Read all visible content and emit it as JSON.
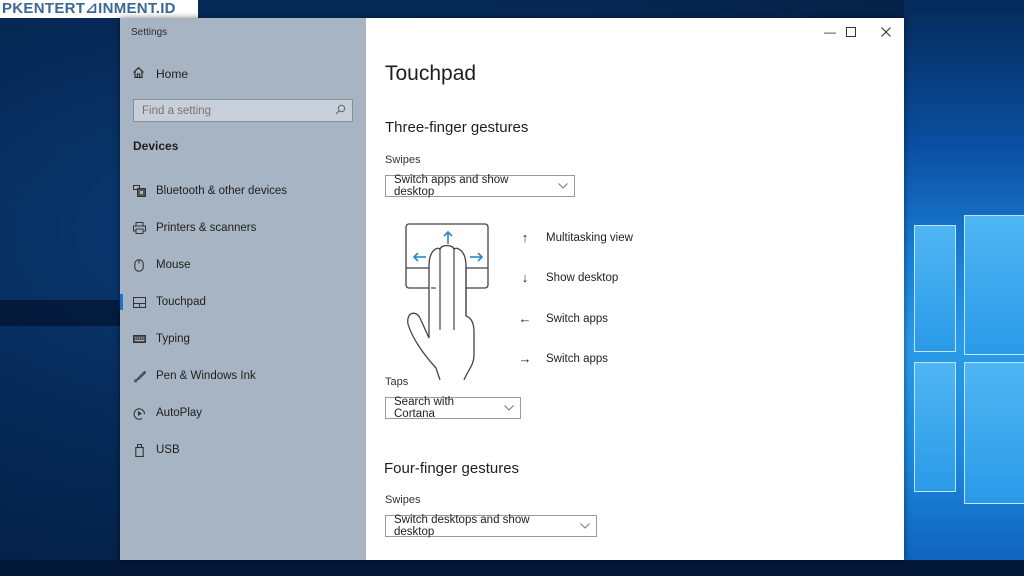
{
  "watermark": "PKENTERT⊿INMENT.ID",
  "window": {
    "title": "Settings",
    "controls": {
      "minimize": "—",
      "maximize": "☐",
      "close": "✕"
    }
  },
  "sidebar": {
    "home_label": "Home",
    "search": {
      "placeholder": "Find a setting",
      "value": ""
    },
    "section_title": "Devices",
    "items": [
      {
        "label": "Bluetooth & other devices",
        "icon": "bluetooth-devices-icon",
        "active": false
      },
      {
        "label": "Printers & scanners",
        "icon": "printer-icon",
        "active": false
      },
      {
        "label": "Mouse",
        "icon": "mouse-icon",
        "active": false
      },
      {
        "label": "Touchpad",
        "icon": "touchpad-icon",
        "active": true
      },
      {
        "label": "Typing",
        "icon": "keyboard-icon",
        "active": false
      },
      {
        "label": "Pen & Windows Ink",
        "icon": "pen-icon",
        "active": false
      },
      {
        "label": "AutoPlay",
        "icon": "autoplay-icon",
        "active": false
      },
      {
        "label": "USB",
        "icon": "usb-icon",
        "active": false
      }
    ]
  },
  "main": {
    "page_title": "Touchpad",
    "three_finger": {
      "heading": "Three-finger gestures",
      "swipes_label": "Swipes",
      "swipes_value": "Switch apps and show desktop",
      "gestures": [
        {
          "arrow": "↑",
          "label": "Multitasking view"
        },
        {
          "arrow": "↓",
          "label": "Show desktop"
        },
        {
          "arrow": "←",
          "label": "Switch apps"
        },
        {
          "arrow": "→",
          "label": "Switch apps"
        }
      ],
      "taps_label": "Taps",
      "taps_value": "Search with Cortana"
    },
    "four_finger": {
      "heading": "Four-finger gestures",
      "swipes_label": "Swipes",
      "swipes_value": "Switch desktops and show desktop"
    }
  },
  "colors": {
    "accent": "#1a74d2",
    "sidebar_bg": "#a7b4c3",
    "illustration_arrow": "#2a86c8"
  }
}
